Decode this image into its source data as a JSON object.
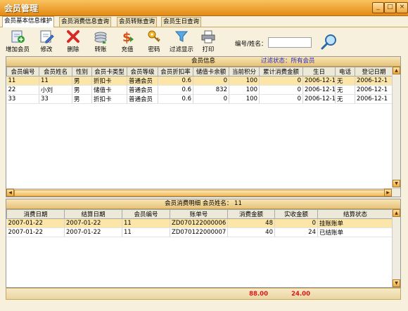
{
  "window": {
    "title": "会员管理"
  },
  "tabs": [
    {
      "label": "会员基本信息维护"
    },
    {
      "label": "会员消费信息查询"
    },
    {
      "label": "会员转账查询"
    },
    {
      "label": "会员生日查询"
    }
  ],
  "toolbar": {
    "items": [
      {
        "label": "增加会员",
        "icon": "add-user-icon"
      },
      {
        "label": "修改",
        "icon": "edit-icon"
      },
      {
        "label": "删除",
        "icon": "delete-icon"
      },
      {
        "label": "转账",
        "icon": "transfer-icon"
      },
      {
        "label": "充值",
        "icon": "recharge-icon"
      },
      {
        "label": "密码",
        "icon": "key-icon"
      },
      {
        "label": "过滤显示",
        "icon": "filter-icon"
      },
      {
        "label": "打印",
        "icon": "printer-icon"
      }
    ]
  },
  "search": {
    "label": "编号/姓名：",
    "value": ""
  },
  "member_panel": {
    "title": "会员信息",
    "filter": "过滤状态：所有会员"
  },
  "member_table": {
    "columns": [
      "会员编号",
      "会员姓名",
      "性别",
      "会员卡类型",
      "会员等级",
      "会员折扣率",
      "储值卡余额",
      "当前积分",
      "累计消费金额",
      "生日",
      "电话",
      "登记日期"
    ],
    "rows": [
      [
        "11",
        "11",
        "男",
        "折扣卡",
        "普通会员",
        "0.6",
        "0",
        "100",
        "0",
        "2006-12-1",
        "无",
        "2006-12-1"
      ],
      [
        "22",
        "小刘",
        "男",
        "储值卡",
        "普通会员",
        "0.6",
        "832",
        "100",
        "0",
        "2006-12-1",
        "无",
        "2006-12-1"
      ],
      [
        "33",
        "33",
        "男",
        "折扣卡",
        "普通会员",
        "0.6",
        "0",
        "100",
        "0",
        "2006-12-1",
        "无",
        "2006-12-1"
      ]
    ]
  },
  "detail_panel": {
    "title": "会员消费明细 会员姓名：",
    "member_name": "11"
  },
  "detail_table": {
    "columns": [
      "消费日期",
      "结算日期",
      "会员编号",
      "账单号",
      "消费金额",
      "实收金额",
      "结算状态"
    ],
    "rows": [
      [
        "2007-01-22",
        "2007-01-22",
        "11",
        "ZD070122000006",
        "48",
        "0",
        "挂账账单"
      ],
      [
        "2007-01-22",
        "2007-01-22",
        "11",
        "ZD070122000007",
        "40",
        "24",
        "已结账单"
      ]
    ]
  },
  "totals": {
    "consume": "88.00",
    "received": "24.00"
  },
  "colors": {
    "titlebar": "#e48a13",
    "selected_row": "#fbe6a8",
    "filter_text": "#2a28c8",
    "total_text": "#e01616"
  }
}
